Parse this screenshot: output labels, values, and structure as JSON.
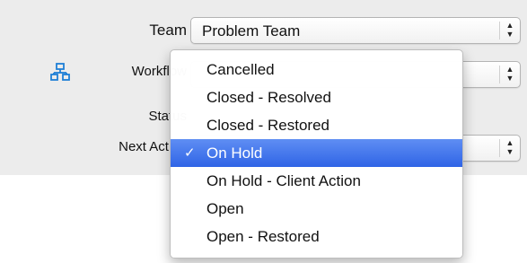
{
  "form": {
    "team_label": "Team",
    "team_value": "Problem Team",
    "workflow_label": "Workflow",
    "status_label": "Status",
    "next_action_label": "Next Action"
  },
  "dropdown": {
    "items": [
      {
        "label": "Cancelled",
        "selected": false
      },
      {
        "label": "Closed - Resolved",
        "selected": false
      },
      {
        "label": "Closed - Restored",
        "selected": false
      },
      {
        "label": "On Hold",
        "selected": true
      },
      {
        "label": "On Hold - Client Action",
        "selected": false
      },
      {
        "label": "Open",
        "selected": false
      },
      {
        "label": "Open - Restored",
        "selected": false
      }
    ],
    "check_mark": "✓"
  },
  "icons": {
    "workflow": "workflow-hierarchy-icon",
    "select_arrows": "up-down-chevron-icon"
  },
  "colors": {
    "panel_bg": "#ececec",
    "selected_bg": "#2f64e6",
    "icon_blue": "#1f7fd6"
  }
}
